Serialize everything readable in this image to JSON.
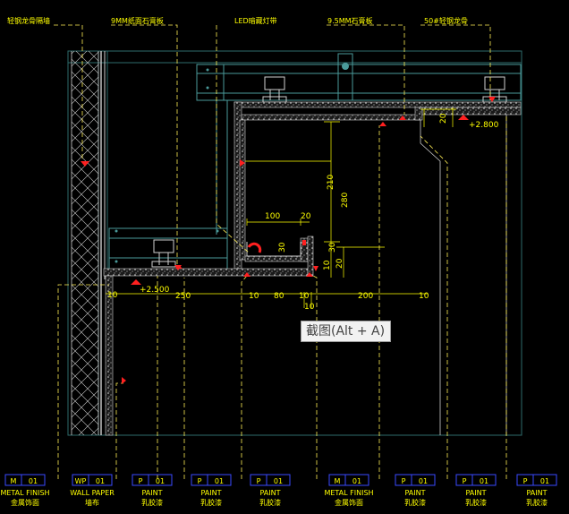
{
  "callouts_top": [
    {
      "text": "轻钢龙骨隔墙"
    },
    {
      "text": "9MM纸面石膏板"
    },
    {
      "text": "LED暗藏灯带"
    },
    {
      "text": "9.5MM石膏板"
    },
    {
      "text": "50#轻钢龙骨"
    }
  ],
  "dimensions": {
    "d20_top": "20",
    "d2800": "+2.800",
    "d210": "210",
    "d280": "280",
    "d100": "100",
    "d20_mid": "20",
    "d30_a": "30",
    "d30_b": "30",
    "d10_a": "10",
    "d20_b": "20",
    "d2500": "+2.500",
    "d10_l": "10",
    "d250": "250",
    "d10_m": "10",
    "d80": "80",
    "d10_r": "10",
    "d10_s": "10",
    "d200": "200",
    "d10_e": "10"
  },
  "tooltip": "截图(Alt + A)",
  "legend": [
    {
      "code": "M",
      "num": "01",
      "en": "METAL FINISH",
      "cn": "金属饰面"
    },
    {
      "code": "WP",
      "num": "01",
      "en": "WALL PAPER",
      "cn": "墙布"
    },
    {
      "code": "P",
      "num": "01",
      "en": "PAINT",
      "cn": "乳胶漆"
    },
    {
      "code": "P",
      "num": "01",
      "en": "PAINT",
      "cn": "乳胶漆"
    },
    {
      "code": "P",
      "num": "01",
      "en": "PAINT",
      "cn": "乳胶漆"
    },
    {
      "code": "M",
      "num": "01",
      "en": "METAL FINISH",
      "cn": "金属饰面"
    },
    {
      "code": "P",
      "num": "01",
      "en": "PAINT",
      "cn": "乳胶漆"
    },
    {
      "code": "P",
      "num": "01",
      "en": "PAINT",
      "cn": "乳胶漆"
    },
    {
      "code": "P",
      "num": "01",
      "en": "PAINT",
      "cn": "乳胶漆"
    }
  ],
  "colors": {
    "background": "#000000",
    "frame": "#2e6b6b",
    "structure": "#4a9a9a",
    "board": "#cfcfcf",
    "dimension": "#ffff00",
    "leader": "#ffee55",
    "arrow": "#ff0000",
    "legend_box": "#3a4aff",
    "hatch": "#d0d0d0"
  }
}
